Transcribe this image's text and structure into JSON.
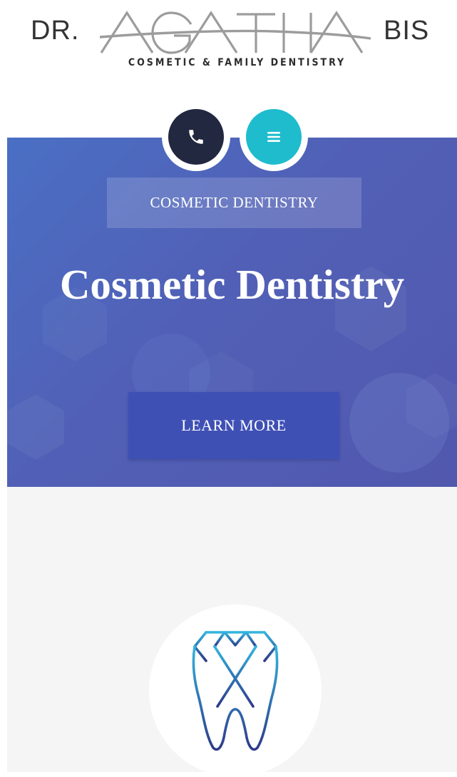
{
  "logo": {
    "prefix": "DR.",
    "name": "AGATHA",
    "suffix": "BIS",
    "tagline": "COSMETIC & FAMILY DENTISTRY"
  },
  "header_buttons": {
    "phone_icon": "phone-icon",
    "menu_icon": "hamburger-menu-icon"
  },
  "hero": {
    "kicker": "COSMETIC DENTISTRY",
    "title": "Cosmetic Dentistry",
    "cta_label": "LEARN MORE"
  },
  "feature": {
    "icon": "tooth-icon"
  },
  "colors": {
    "hero_blue": "#5160b6",
    "cta_blue": "#3f50b5",
    "phone_navy": "#22283f",
    "menu_teal": "#1ebccd",
    "section_gray": "#f5f5f6"
  }
}
